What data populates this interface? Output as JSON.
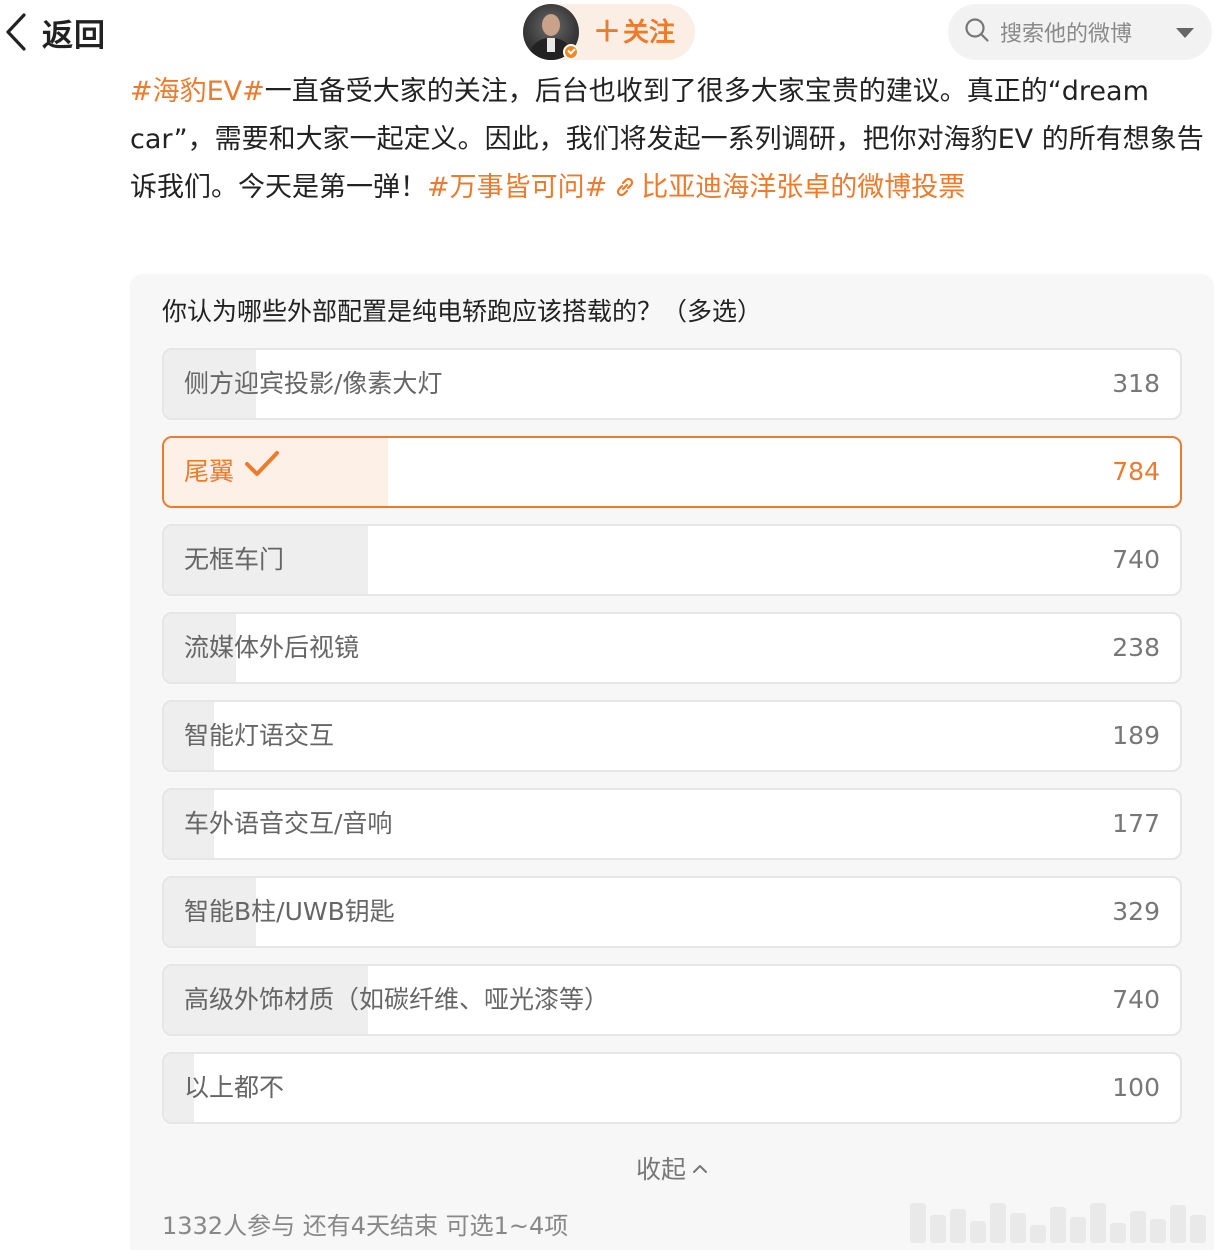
{
  "header": {
    "back_label": "返回",
    "follow_label": "关注",
    "search_placeholder": "搜索他的微博"
  },
  "post": {
    "tag1": "#海豹EV#",
    "text1": "一直备受大家的关注，后台也收到了很多大家宝贵的建议。真正的“dream car”，需要和大家一起定义。因此，我们将发起一系列调研，把你对海豹EV 的所有想象告诉我们。今天是第一弹！",
    "tag2": "#万事皆可问#",
    "link_text": "比亚迪海洋张卓的微博投票",
    "accent_color": "#ee7a2c"
  },
  "poll": {
    "question": "你认为哪些外部配置是纯电轿跑应该搭载的？（多选）",
    "options": [
      {
        "label": "侧方迎宾投影/像素大灯",
        "count": "318",
        "share": 0.0906,
        "selected": false
      },
      {
        "label": "尾翼",
        "count": "784",
        "share": 0.2205,
        "selected": true
      },
      {
        "label": "无框车门",
        "count": "740",
        "share": 0.2005,
        "selected": false
      },
      {
        "label": "流媒体外后视镜",
        "count": "238",
        "share": 0.0706,
        "selected": false
      },
      {
        "label": "智能灯语交互",
        "count": "189",
        "share": 0.0496,
        "selected": false
      },
      {
        "label": "车外语音交互/音响",
        "count": "177",
        "share": 0.0496,
        "selected": false
      },
      {
        "label": "智能B柱/UWB钥匙",
        "count": "329",
        "share": 0.0906,
        "selected": false
      },
      {
        "label": "高级外饰材质（如碳纤维、哑光漆等）",
        "count": "740",
        "share": 0.2005,
        "selected": false
      },
      {
        "label": "以上都不",
        "count": "100",
        "share": 0.0296,
        "selected": false
      }
    ],
    "collapse_label": "收起",
    "footer": "1332人参与 还有4天结束 可选1~4项"
  }
}
